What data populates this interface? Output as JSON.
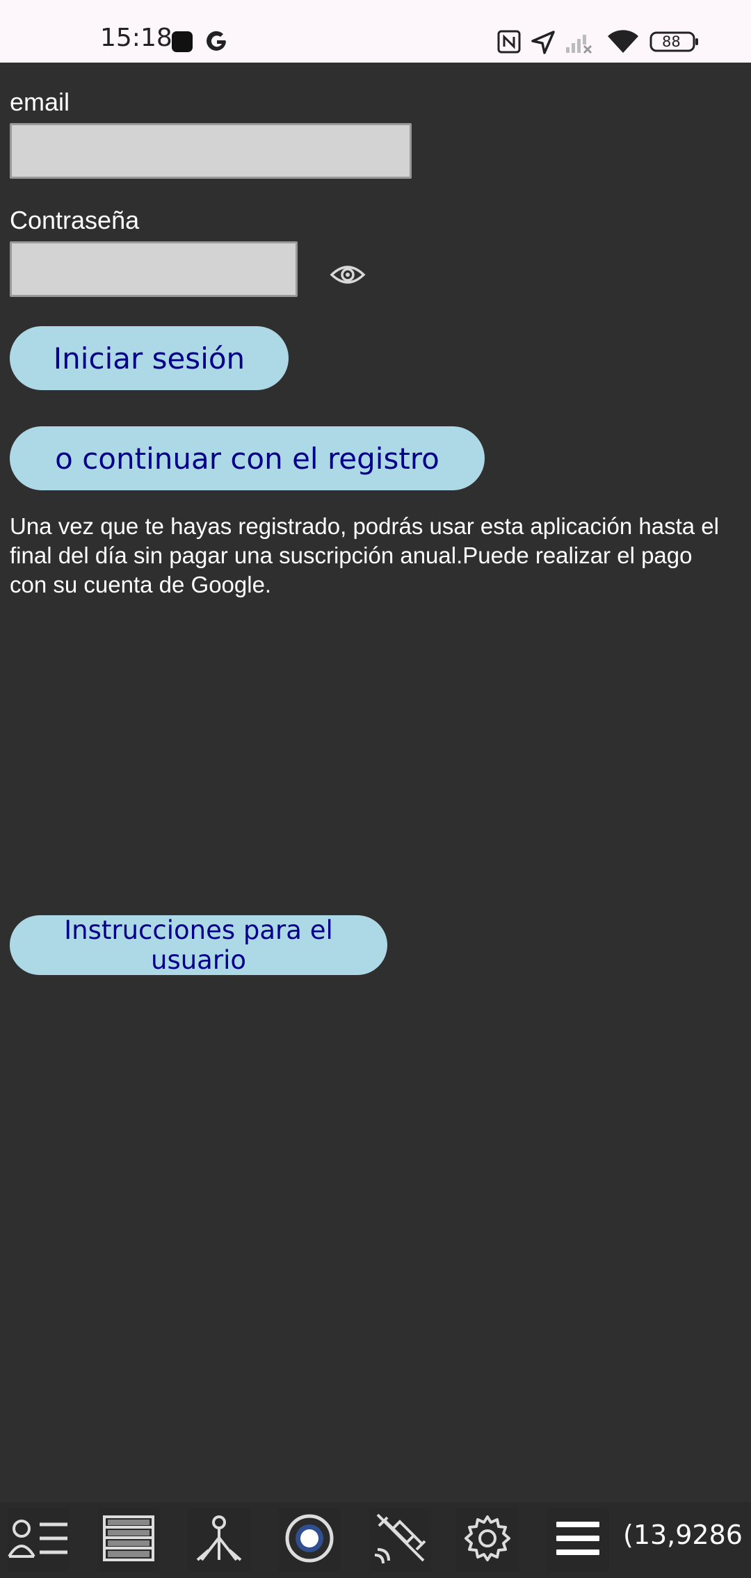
{
  "status_bar": {
    "time": "15:18",
    "battery_level": "88",
    "icons": [
      "notification-square-icon",
      "google-icon",
      "nfc-icon",
      "location-arrow-icon",
      "signal-off-icon",
      "wifi-icon",
      "battery-icon"
    ]
  },
  "login_form": {
    "email_label": "email",
    "email_value": "",
    "password_label": "Contraseña",
    "password_value": "",
    "login_button": "Iniciar sesión",
    "register_button": "o continuar con el registro",
    "info_text": "Una vez que te hayas registrado, podrás usar esta aplicación hasta el final del día sin pagar una suscripción anual.Puede realizar el pago con su cuenta de Google.",
    "instructions_button": "Instrucciones para el usuario"
  },
  "toolbar": {
    "items": [
      "user-list-icon",
      "table-icon",
      "survey-tripod-icon",
      "record-target-icon",
      "satellite-off-icon",
      "settings-gear-icon",
      "menu-icon"
    ],
    "coordinates": "(13,9286"
  },
  "colors": {
    "background": "#2f2f2f",
    "button_bg": "#add8e6",
    "button_text": "#00008b",
    "input_bg": "#d3d3d3"
  }
}
